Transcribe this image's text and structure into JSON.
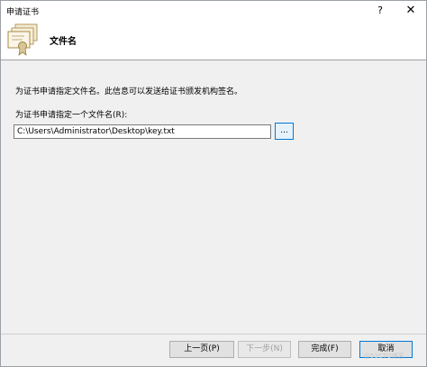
{
  "window": {
    "title": "申请证书",
    "help_symbol": "?",
    "close_symbol": "✕"
  },
  "header": {
    "icon": "certificate-icon",
    "title": "文件名"
  },
  "content": {
    "description": "为证书申请指定文件名。此信息可以发送给证书颁发机构签名。",
    "field_label": "为证书申请指定一个文件名(R):",
    "path_value": "C:\\Users\\Administrator\\Desktop\\key.txt",
    "browse_label": "..."
  },
  "footer": {
    "prev_label": "上一页(P)",
    "next_label": "下一步(N)",
    "finish_label": "完成(F)",
    "cancel_label": "取消"
  },
  "watermark": "@51CTO博客"
}
